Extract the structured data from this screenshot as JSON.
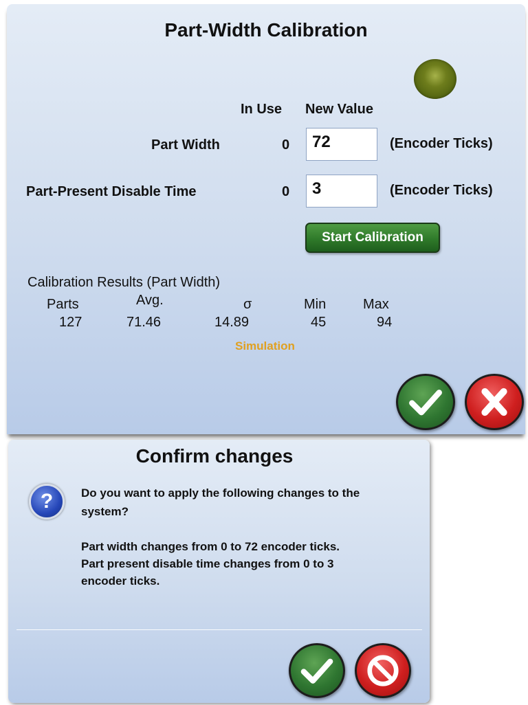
{
  "calibration": {
    "title": "Part-Width Calibration",
    "columns": {
      "in_use": "In Use",
      "new_value": "New Value"
    },
    "rows": [
      {
        "label": "Part Width",
        "in_use": "0",
        "new_value": "72",
        "unit": "(Encoder Ticks)"
      },
      {
        "label": "Part-Present Disable Time",
        "in_use": "0",
        "new_value": "3",
        "unit": "(Encoder Ticks)"
      }
    ],
    "start_button": "Start Calibration",
    "results": {
      "title": "Calibration Results (Part Width)",
      "headers": [
        "Parts",
        "Avg.",
        "σ",
        "Min",
        "Max"
      ],
      "values": [
        "127",
        "71.46",
        "14.89",
        "45",
        "94"
      ]
    },
    "status_text": "Simulation",
    "status_color": "#e0a020",
    "indicator_color": "#556b12",
    "ok_icon": "checkmark-icon",
    "cancel_icon": "x-icon"
  },
  "confirm": {
    "title": "Confirm changes",
    "icon": "question-icon",
    "icon_glyph": "?",
    "message_lines": [
      "Do you want to apply the following changes to the",
      "system?",
      "",
      "Part width changes from 0 to 72 encoder ticks.",
      "Part present disable time changes from 0 to 3",
      "encoder ticks."
    ],
    "ok_icon": "checkmark-icon",
    "cancel_icon": "prohibited-icon"
  }
}
